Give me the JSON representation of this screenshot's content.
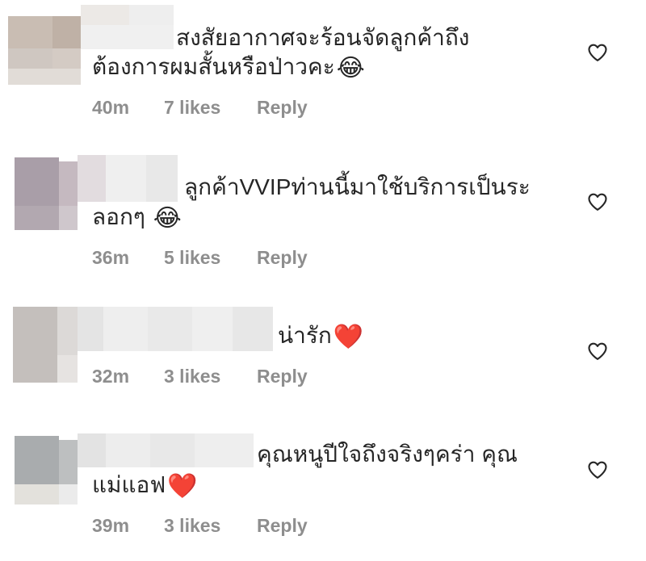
{
  "comments": [
    {
      "line1": "สงสัยอากาศจะร้อนจัดลูกค้าถึง",
      "line2": "ต้องการผมสั้นหรือป่าวคะ",
      "emoji": "😂",
      "time": "40m",
      "likes": "7 likes",
      "reply": "Reply"
    },
    {
      "line1": "ลูกค้าVVIPท่านนี้มาใช้บริการเป็นระ",
      "line2": "ลอกๆ",
      "emoji": "😂",
      "time": "36m",
      "likes": "5 likes",
      "reply": "Reply"
    },
    {
      "line1": "น่ารัก",
      "line2": "",
      "emoji": "❤️",
      "time": "32m",
      "likes": "3 likes",
      "reply": "Reply"
    },
    {
      "line1": "คุณหนูปีใจถึงจริงๆคร่า คุณ",
      "line2": "แม่แอฟ",
      "emoji": "❤️",
      "time": "39m",
      "likes": "3 likes",
      "reply": "Reply"
    }
  ],
  "icons": {
    "like": "heart-outline-icon"
  },
  "colors": {
    "text": "#262626",
    "meta": "#8e8e8e",
    "heart": "#262626"
  }
}
